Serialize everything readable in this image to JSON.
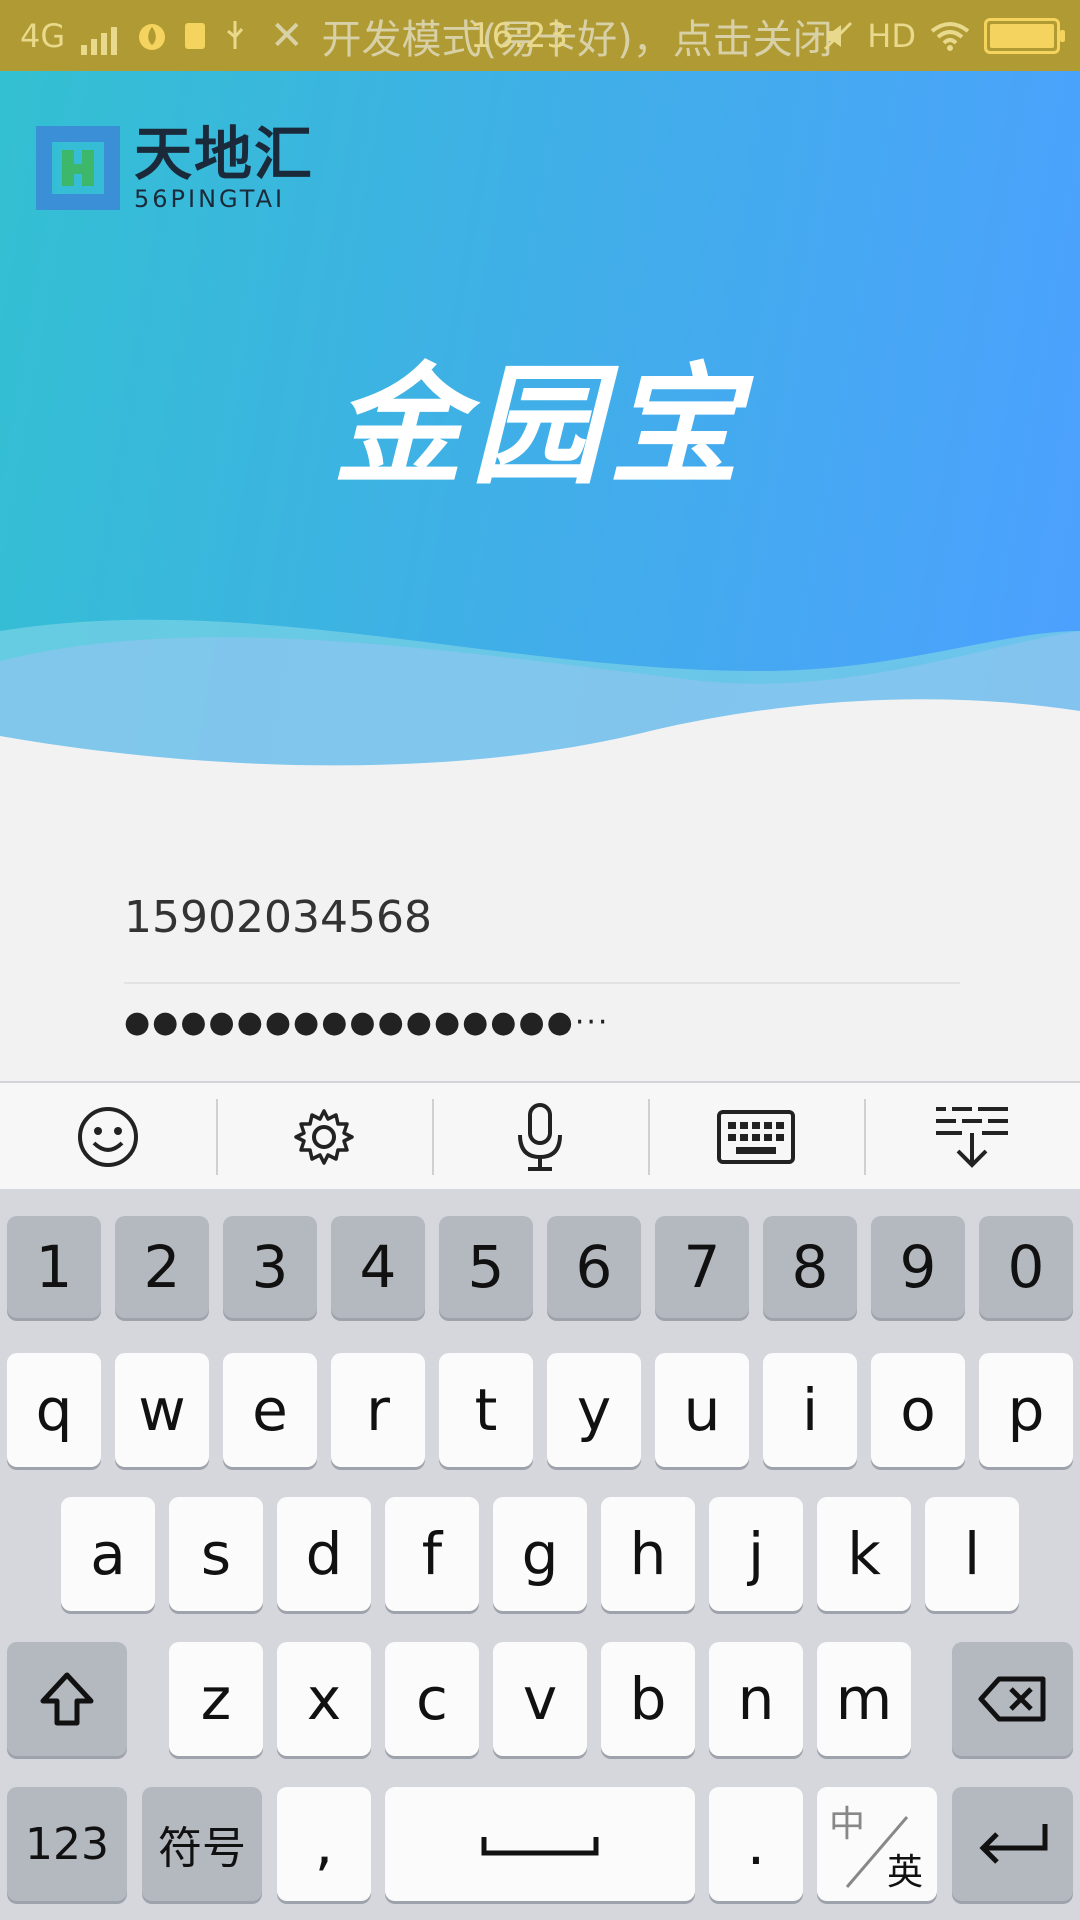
{
  "status_bar": {
    "network": "4G",
    "dev_mode_notice": "开发模式(易卡好)，点击关闭",
    "time": "16:23",
    "hd": "HD"
  },
  "header": {
    "brand_name": "天地汇",
    "brand_sub": "56PINGTAI",
    "app_title": "金园宝",
    "accent_colors": [
      "#33c0d2",
      "#4da0ff"
    ]
  },
  "form": {
    "phone_value": "15902034568",
    "password_mask": "●●●●●●●●●●●●●●●●···"
  },
  "keyboard_toolbar": {
    "items": [
      "emoji-icon",
      "settings-icon",
      "microphone-icon",
      "keyboard-icon",
      "hide-keyboard-icon"
    ]
  },
  "keyboard": {
    "row_numbers": [
      "1",
      "2",
      "3",
      "4",
      "5",
      "6",
      "7",
      "8",
      "9",
      "0"
    ],
    "row_q": [
      "q",
      "w",
      "e",
      "r",
      "t",
      "y",
      "u",
      "i",
      "o",
      "p"
    ],
    "row_a": [
      "a",
      "s",
      "d",
      "f",
      "g",
      "h",
      "j",
      "k",
      "l"
    ],
    "row_z": [
      "z",
      "x",
      "c",
      "v",
      "b",
      "n",
      "m"
    ],
    "key_123": "123",
    "key_symbols": "符号",
    "key_comma": ",",
    "key_period": ".",
    "key_lang_top": "中",
    "key_lang_bottom": "英"
  }
}
